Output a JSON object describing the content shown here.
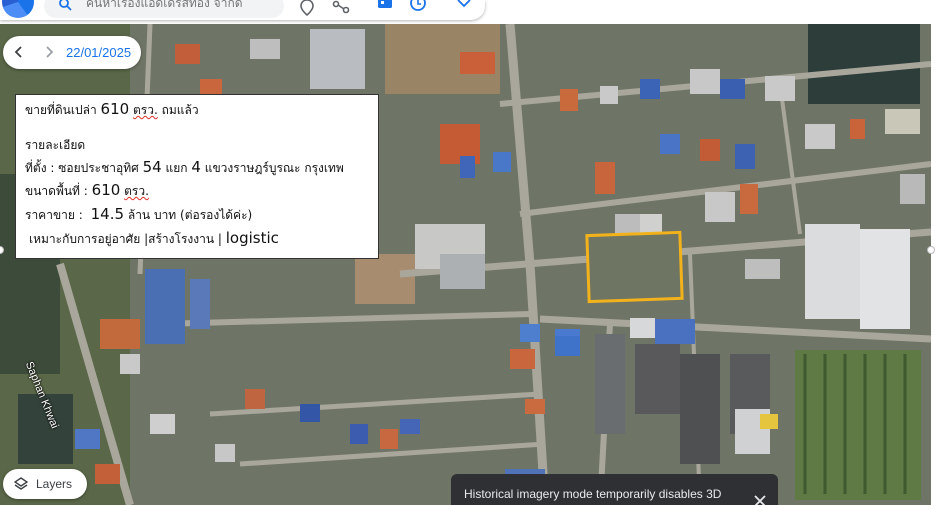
{
  "search": {
    "placeholder": "ค้นหาเรื่องแอดเดรสทอง จากด"
  },
  "timeline": {
    "date": "22/01/2025"
  },
  "listing": {
    "title_prefix": "ขายที่ดินเปล่า",
    "title_size": "610",
    "title_unit": "ตรว.",
    "title_suffix": "ถมแล้ว",
    "details_heading": "รายละเอียด",
    "location_prefix": "ที่ตั้ง : ซอยประชาอุทิศ",
    "location_soi": "54",
    "location_mid": "แยก",
    "location_branch": "4",
    "location_suffix": "แขวงราษฎร์บูรณะ กรุงเทพ",
    "area_label": "ขนาดพื้นที่ :",
    "area_value": "610",
    "area_unit": "ตรว.",
    "price_label": "ราคาขาย :",
    "price_value": "14.5",
    "price_suffix": "ล้าน บาท (ต่อรองได้ค่ะ)",
    "use_thai": "เหมาะกับการอยู่อาศัย |สร้างโรงงาน |",
    "use_en": "logistic"
  },
  "map": {
    "street_label": "Saphan Khwai",
    "highlight_color": "#f2b21b"
  },
  "layers_button": {
    "label": "Layers"
  },
  "toast": {
    "message": "Historical imagery mode temporarily disables 3D"
  },
  "icons": [
    "search-icon",
    "pin-icon",
    "route-icon",
    "calendar-icon",
    "history-icon",
    "diamond-icon",
    "chevron-left-icon",
    "chevron-right-icon",
    "layers-icon",
    "close-icon"
  ]
}
